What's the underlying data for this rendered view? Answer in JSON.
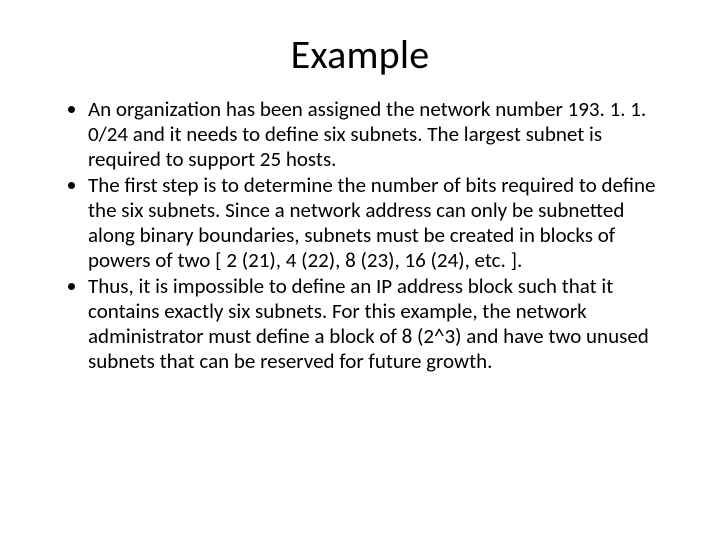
{
  "title": "Example",
  "bullets": [
    "An organization has been assigned the network number 193. 1. 1. 0/24 and it needs to define six subnets. The largest subnet is required to support 25 hosts.",
    "The first step is to determine the number of bits required to define the six subnets. Since a network address can only be subnetted along binary boundaries, subnets must be created in blocks of powers of two [ 2 (21), 4 (22), 8 (23), 16 (24), etc. ].",
    "Thus, it is impossible to define an IP address block such that it contains exactly six subnets. For this example, the network administrator must define a block of 8 (2^3) and have two unused subnets that can be reserved for future growth."
  ]
}
